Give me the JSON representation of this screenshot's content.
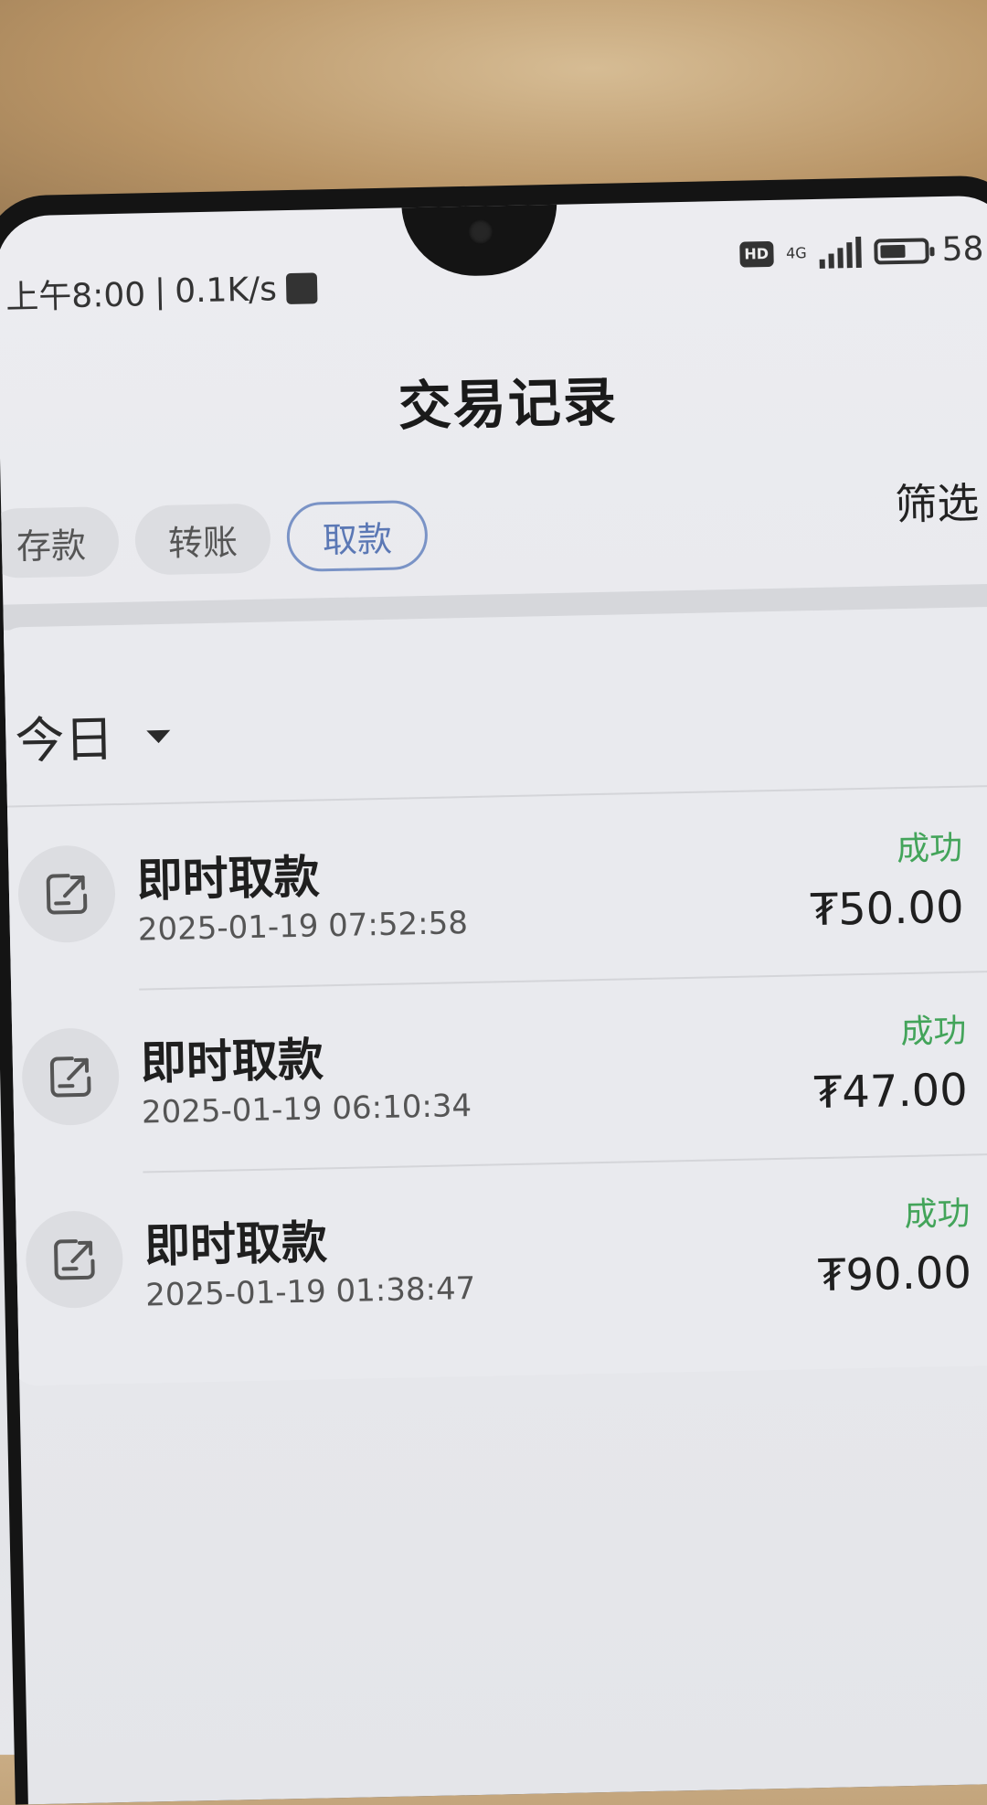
{
  "status_bar": {
    "time": "上午8:00",
    "separator": "|",
    "speed": "0.1K/s",
    "hd_label": "HD",
    "network": "4G",
    "battery_percent": "58",
    "percent_sign": "%",
    "battery_level": 0.58
  },
  "header": {
    "title": "交易记录"
  },
  "tabs": {
    "items": [
      {
        "label": "存款"
      },
      {
        "label": "转账"
      },
      {
        "label": "取款"
      }
    ],
    "active": "取款"
  },
  "filter": {
    "label": "筛选"
  },
  "date_group": {
    "label": "今日"
  },
  "transactions": [
    {
      "title": "即时取款",
      "time": "2025-01-19 07:52:58",
      "status": "成功",
      "amount": "₮50.00"
    },
    {
      "title": "即时取款",
      "time": "2025-01-19 06:10:34",
      "status": "成功",
      "amount": "₮47.00"
    },
    {
      "title": "即时取款",
      "time": "2025-01-19 01:38:47",
      "status": "成功",
      "amount": "₮90.00"
    }
  ],
  "colors": {
    "accent": "#5b78b5",
    "success": "#43a45a"
  },
  "icons": {
    "withdraw": "withdraw-icon",
    "chevron": "chevron-right-icon",
    "dropdown": "caret-down-icon"
  }
}
